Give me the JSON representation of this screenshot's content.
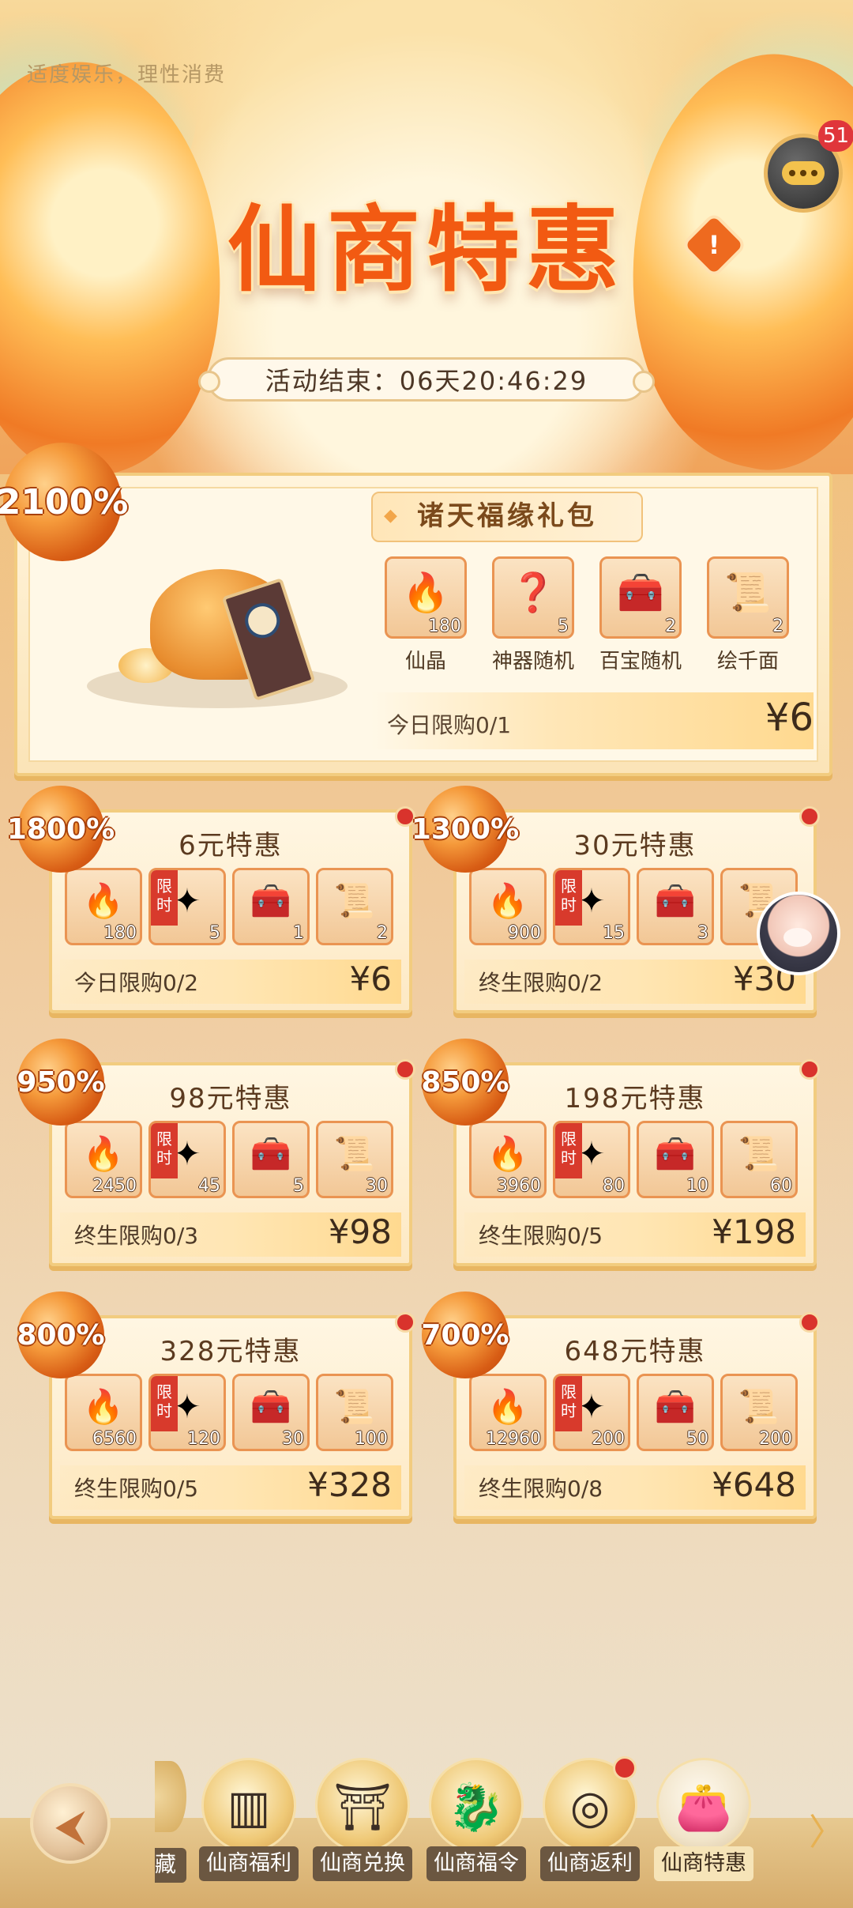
{
  "header": {
    "notice": "适度娱乐，理性消费",
    "title": "仙商特惠",
    "chat_badge": "51",
    "timer": "活动结束：06天20:46:29"
  },
  "big_pack": {
    "badge": "2100%",
    "title": "诸天福缘礼包",
    "items": [
      {
        "name": "仙晶",
        "count": "180",
        "icon": "crystal-icon"
      },
      {
        "name": "神器随机",
        "count": "5",
        "icon": "mystery-box-icon"
      },
      {
        "name": "百宝随机",
        "count": "2",
        "icon": "treasure-chest-icon"
      },
      {
        "name": "绘千面",
        "count": "2",
        "icon": "scroll-icon"
      }
    ],
    "limit": "今日限购0/1",
    "price": "¥6"
  },
  "limit_tag": "限时",
  "cards": [
    {
      "badge": "1800%",
      "title": "6元特惠",
      "counts": [
        "180",
        "5",
        "1",
        "2"
      ],
      "limit": "今日限购0/2",
      "price": "¥6"
    },
    {
      "badge": "1300%",
      "title": "30元特惠",
      "counts": [
        "900",
        "15",
        "3",
        ""
      ],
      "limit": "终生限购0/2",
      "price": "¥30"
    },
    {
      "badge": "950%",
      "title": "98元特惠",
      "counts": [
        "2450",
        "45",
        "5",
        "30"
      ],
      "limit": "终生限购0/3",
      "price": "¥98"
    },
    {
      "badge": "850%",
      "title": "198元特惠",
      "counts": [
        "3960",
        "80",
        "10",
        "60"
      ],
      "limit": "终生限购0/5",
      "price": "¥198"
    },
    {
      "badge": "800%",
      "title": "328元特惠",
      "counts": [
        "6560",
        "120",
        "30",
        "100"
      ],
      "limit": "终生限购0/5",
      "price": "¥328"
    },
    {
      "badge": "700%",
      "title": "648元特惠",
      "counts": [
        "12960",
        "200",
        "50",
        "200"
      ],
      "limit": "终生限购0/8",
      "price": "¥648"
    }
  ],
  "nav": {
    "partial_label": "藏",
    "tabs": [
      {
        "label": "仙商福利",
        "icon": "bamboo-scroll-icon"
      },
      {
        "label": "仙商兑换",
        "icon": "pavilion-icon"
      },
      {
        "label": "仙商福令",
        "icon": "dragon-statue-icon"
      },
      {
        "label": "仙商返利",
        "icon": "coin-pile-icon"
      },
      {
        "label": "仙商特惠",
        "icon": "gift-pouch-icon"
      }
    ]
  }
}
